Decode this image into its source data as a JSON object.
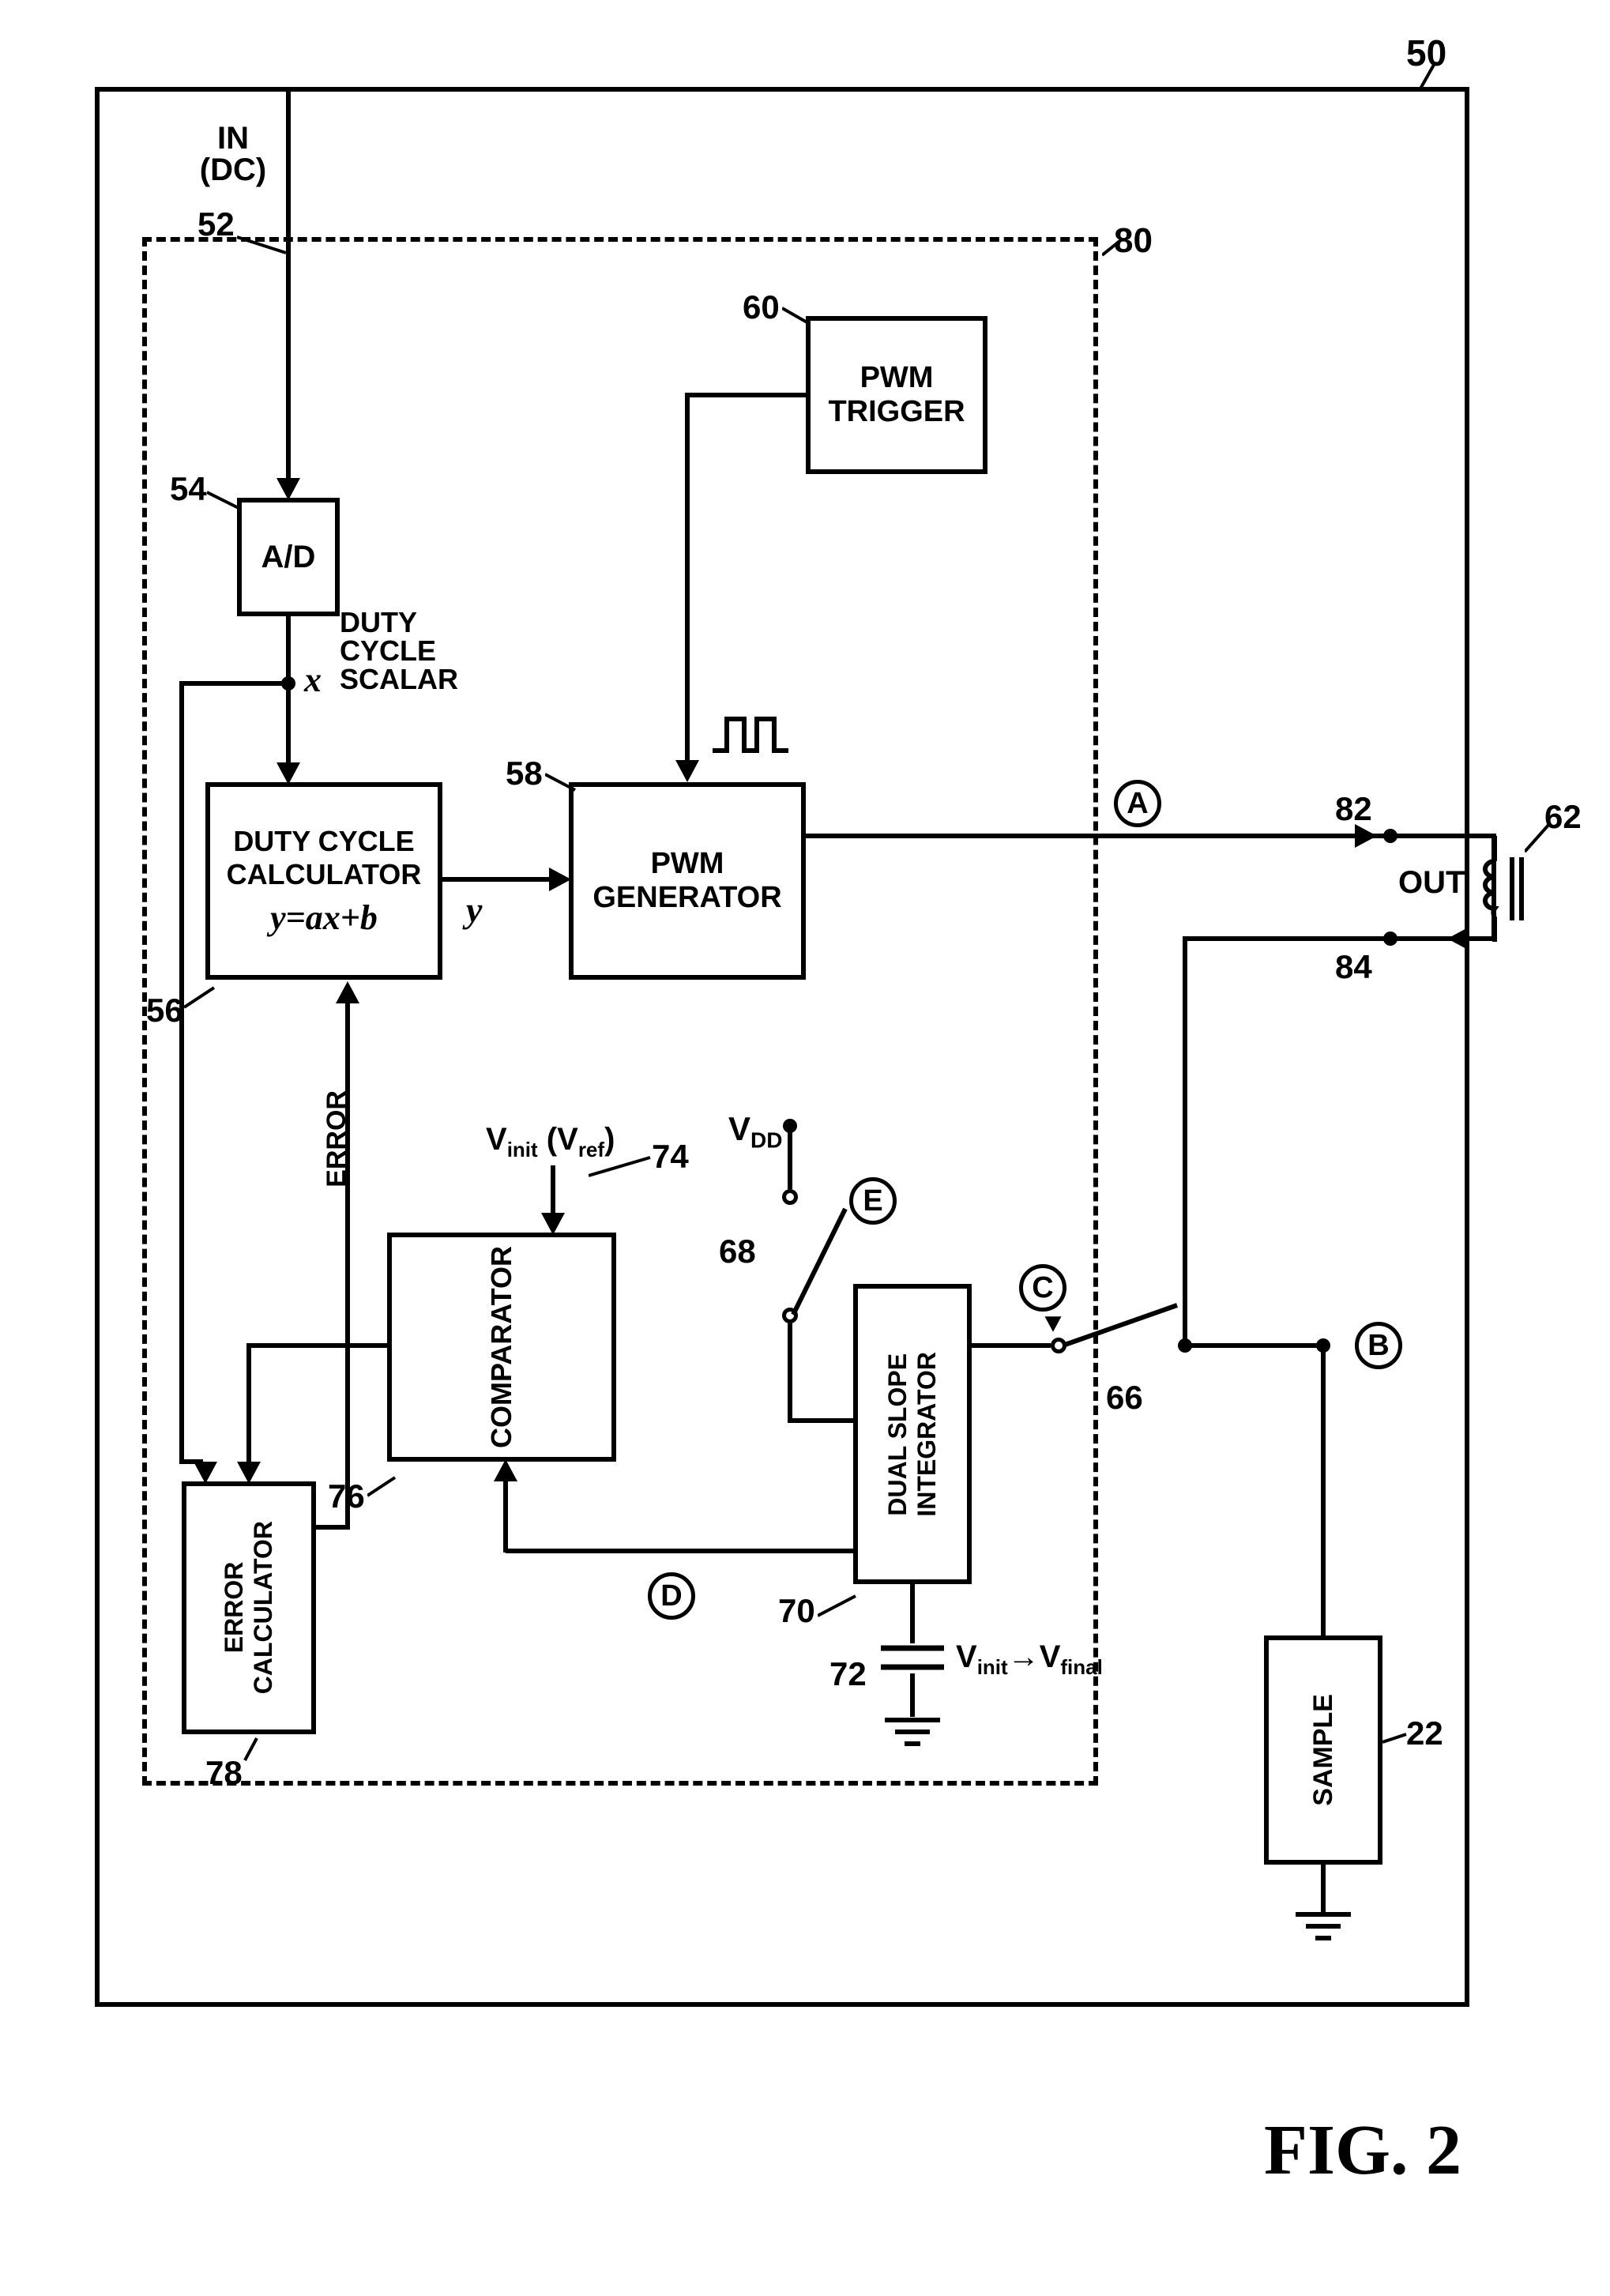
{
  "figure_label": "FIG. 2",
  "refs": {
    "r50": "50",
    "r52": "52",
    "r54": "54",
    "r56": "56",
    "r58": "58",
    "r60": "60",
    "r62": "62",
    "r66": "66",
    "r68": "68",
    "r70": "70",
    "r72": "72",
    "r74": "74",
    "r76": "76",
    "r78": "78",
    "r80": "80",
    "r82": "82",
    "r84": "84",
    "r22": "22"
  },
  "blocks": {
    "ad": "A/D",
    "duty_calc_l1": "DUTY CYCLE",
    "duty_calc_l2": "CALCULATOR",
    "pwm_gen_l1": "PWM",
    "pwm_gen_l2": "GENERATOR",
    "pwm_trig_l1": "PWM",
    "pwm_trig_l2": "TRIGGER",
    "error_calc_l1": "ERROR",
    "error_calc_l2": "CALCULATOR",
    "comparator": "COMPARATOR",
    "dual_slope_l1": "DUAL SLOPE",
    "dual_slope_l2": "INTEGRATOR",
    "sample": "SAMPLE"
  },
  "text": {
    "in_l1": "IN",
    "in_l2": "(DC)",
    "out": "OUT",
    "duty_cycle_scalar_l1": "DUTY",
    "duty_cycle_scalar_l2": "CYCLE",
    "duty_cycle_scalar_l3": "SCALAR",
    "x": "x",
    "y": "y",
    "eq": "y=ax+b",
    "error": "ERROR",
    "vdd": "V",
    "vdd_sub": "DD",
    "vinit": "V",
    "vinit_sub": "init",
    "vref": " (V",
    "vref_sub": "ref",
    "vref_close": ")",
    "vfinal_l": "V",
    "vfinal_sub": "init",
    "vfinal_arrow": "→",
    "vfinal_r": "V",
    "vfinal_rsub": "final"
  },
  "nodes": {
    "A": "A",
    "B": "B",
    "C": "C",
    "D": "D",
    "E": "E"
  },
  "chart_data": {
    "type": "diagram",
    "title": "FIG. 2 — PWM feedback control block diagram",
    "blocks": [
      {
        "id": 54,
        "name": "A/D",
        "inputs": [
          "IN (DC) 52"
        ],
        "outputs": [
          "x (Duty Cycle Scalar)"
        ]
      },
      {
        "id": 56,
        "name": "Duty Cycle Calculator",
        "equation": "y = a x + b",
        "inputs": [
          "x",
          "ERROR"
        ],
        "outputs": [
          "y"
        ]
      },
      {
        "id": 58,
        "name": "PWM Generator",
        "inputs": [
          "y",
          "PWM Trigger"
        ],
        "outputs": [
          "PWM pulse → A"
        ]
      },
      {
        "id": 60,
        "name": "PWM Trigger",
        "outputs": [
          "trigger → PWM Generator"
        ]
      },
      {
        "id": 78,
        "name": "Error Calculator",
        "inputs": [
          "x",
          "Comparator out"
        ],
        "outputs": [
          "ERROR → Duty Cycle Calculator"
        ]
      },
      {
        "id": 76,
        "name": "Comparator",
        "inputs": [
          "V_init (V_ref) 74",
          "D (integrator out)"
        ],
        "outputs": [
          "→ Error Calculator"
        ]
      },
      {
        "id": 70,
        "name": "Dual Slope Integrator",
        "inputs": [
          "switch 66 (C)",
          "switch 68 (E) from V_DD",
          "cap 72 V_init→V_final"
        ],
        "outputs": [
          "D → Comparator"
        ]
      },
      {
        "id": 22,
        "name": "Sample",
        "terminals": [
          "B",
          "GND"
        ]
      }
    ],
    "external": [
      {
        "id": 62,
        "name": "Load (inductor/transformer)",
        "terminals": [
          "OUT 82",
          "OUT 84"
        ]
      }
    ],
    "switches": [
      {
        "id": 66,
        "label": "C",
        "from": "node near 84 / B",
        "to": "Dual Slope Integrator input"
      },
      {
        "id": 68,
        "label": "E",
        "from": "V_DD",
        "to": "Dual Slope Integrator input"
      }
    ],
    "nets": [
      {
        "name": "A",
        "desc": "PWM Generator output rail → OUT 82"
      },
      {
        "name": "B",
        "desc": "return rail 84 → Sample top node"
      },
      {
        "name": "C",
        "desc": "switch 66 output → integrator in"
      },
      {
        "name": "D",
        "desc": "integrator out → comparator in"
      },
      {
        "name": "E",
        "desc": "switch 68 V_DD → integrator in"
      }
    ],
    "enclosures": [
      {
        "id": 50,
        "type": "solid",
        "contains": "entire circuit except load 62 and sample 22 ground"
      },
      {
        "id": 80,
        "type": "dashed",
        "contains": [
          54,
          56,
          58,
          60,
          78,
          76
        ]
      }
    ]
  }
}
